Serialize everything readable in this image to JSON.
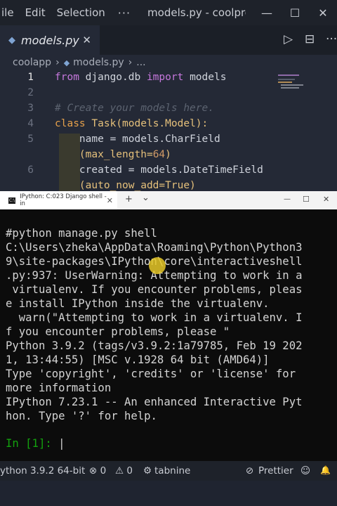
{
  "titlebar": {
    "menu_file": "ile",
    "menu_edit": "Edit",
    "menu_selection": "Selection",
    "more": "···",
    "window_title": "models.py - coolpro...",
    "minimize": "—",
    "maximize": "☐",
    "close": "✕"
  },
  "tab": {
    "icon": "◆",
    "label": "models.py",
    "close": "✕"
  },
  "tab_actions": {
    "run": "▷",
    "split": "⊟",
    "more": "···"
  },
  "breadcrumb": {
    "folder": "coolapp",
    "sep1": "›",
    "file_icon": "◆",
    "file": "models.py",
    "sep2": "›",
    "tail": "..."
  },
  "editor": {
    "lines": [
      {
        "num": "1",
        "tokens": [
          {
            "t": "from",
            "c": "kw"
          },
          {
            "t": " django.db ",
            "c": "plain"
          },
          {
            "t": "import",
            "c": "kw"
          },
          {
            "t": " models",
            "c": "plain"
          }
        ]
      },
      {
        "num": "2",
        "tokens": []
      },
      {
        "num": "3",
        "tokens": [
          {
            "t": "# Create your models here.",
            "c": "cm"
          }
        ]
      },
      {
        "num": "4",
        "tokens": [
          {
            "t": "class",
            "c": "kw2"
          },
          {
            "t": " ",
            "c": "plain"
          },
          {
            "t": "Task",
            "c": "fn"
          },
          {
            "t": "(models.Model):",
            "c": "args"
          }
        ]
      },
      {
        "num": "5",
        "tokens": [
          {
            "t": "    name",
            "c": "plain"
          },
          {
            "t": " = ",
            "c": "plain"
          },
          {
            "t": "models.CharField",
            "c": "plain"
          }
        ]
      },
      {
        "num": "",
        "tokens": [
          {
            "t": "    (max_length=",
            "c": "args"
          },
          {
            "t": "64",
            "c": "num"
          },
          {
            "t": ")",
            "c": "args"
          }
        ]
      },
      {
        "num": "6",
        "tokens": [
          {
            "t": "    created",
            "c": "plain"
          },
          {
            "t": " = ",
            "c": "plain"
          },
          {
            "t": "models.DateTimeField",
            "c": "plain"
          }
        ]
      },
      {
        "num": "",
        "tokens": [
          {
            "t": "    (auto_now_add=True)",
            "c": "args"
          }
        ]
      }
    ]
  },
  "terminal": {
    "tab_title": "IPython: C:023 Django shell - in",
    "new_tab": "+",
    "dropdown": "⌄",
    "min": "—",
    "max": "☐",
    "close": "✕",
    "output": "#python manage.py shell\nC:\\Users\\zheka\\AppData\\Roaming\\Python\\Python3\n9\\site-packages\\IPython\\core\\interactiveshell\n.py:937: UserWarning: Attempting to work in a\n virtualenv. If you encounter problems, pleas\ne install IPython inside the virtualenv.\n  warn(\"Attempting to work in a virtualenv. I\nf you encounter problems, please \"\nPython 3.9.2 (tags/v3.9.2:1a79785, Feb 19 202\n1, 13:44:55) [MSC v.1928 64 bit (AMD64)]\nType 'copyright', 'credits' or 'license' for\nmore information\nIPython 7.23.1 -- An enhanced Interactive Pyt\nhon. Type '?' for help.",
    "prompt": "In [1]: "
  },
  "statusbar": {
    "interpreter": "ython 3.9.2 64-bit",
    "errors": "⊗ 0",
    "warnings": "⚠ 0",
    "tabnine": "tabnine",
    "prettier": "Prettier",
    "feedback": "☺",
    "bell": "🔔"
  }
}
